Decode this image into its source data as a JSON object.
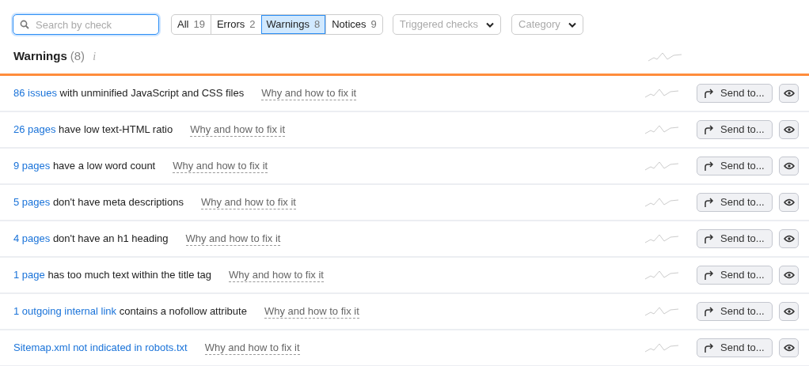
{
  "search": {
    "placeholder": "Search by check"
  },
  "filters": [
    {
      "label": "All",
      "count": "19",
      "selected": false
    },
    {
      "label": "Errors",
      "count": "2",
      "selected": false
    },
    {
      "label": "Warnings",
      "count": "8",
      "selected": true
    },
    {
      "label": "Notices",
      "count": "9",
      "selected": false
    }
  ],
  "dropdowns": [
    "Triggered checks",
    "Category"
  ],
  "section": {
    "title": "Warnings",
    "count": "(8)",
    "info": "i"
  },
  "rows": [
    {
      "link": "86 issues",
      "text": "with unminified JavaScript and CSS files",
      "help": "Why and how to fix it",
      "action": "Send to..."
    },
    {
      "link": "26 pages",
      "text": "have low text-HTML ratio",
      "help": "Why and how to fix it",
      "action": "Send to..."
    },
    {
      "link": "9 pages",
      "text": "have a low word count",
      "help": "Why and how to fix it",
      "action": "Send to..."
    },
    {
      "link": "5 pages",
      "text": "don't have meta descriptions",
      "help": "Why and how to fix it",
      "action": "Send to..."
    },
    {
      "link": "4 pages",
      "text": "don't have an h1 heading",
      "help": "Why and how to fix it",
      "action": "Send to..."
    },
    {
      "link": "1 page",
      "text": "has too much text within the title tag",
      "help": "Why and how to fix it",
      "action": "Send to..."
    },
    {
      "link": "1 outgoing internal link",
      "text": "contains a nofollow attribute",
      "help": "Why and how to fix it",
      "action": "Send to..."
    },
    {
      "link": "Sitemap.xml not indicated in robots.txt",
      "help": "Why and how to fix it",
      "action": "Send to..."
    }
  ]
}
